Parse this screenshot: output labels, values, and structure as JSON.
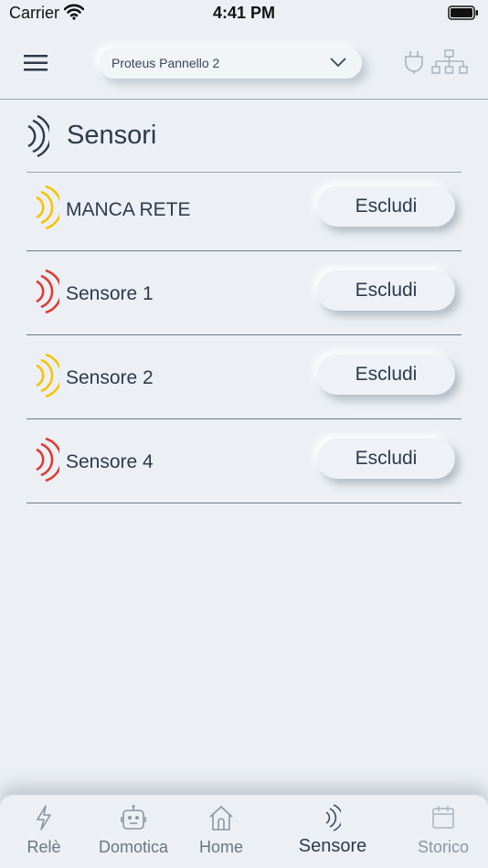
{
  "status_bar": {
    "carrier": "Carrier",
    "time": "4:41 PM"
  },
  "header": {
    "panel_selector": "Proteus Pannello 2",
    "icons": [
      "menu-icon",
      "plug-icon",
      "network-icon"
    ]
  },
  "section": {
    "title": "Sensori",
    "icon": "sensor-wave-icon"
  },
  "sensors": [
    {
      "name": "MANCA RETE",
      "status_color": "#f5c400",
      "action": "Escludi"
    },
    {
      "name": "Sensore 1",
      "status_color": "#e03a32",
      "action": "Escludi"
    },
    {
      "name": "Sensore 2",
      "status_color": "#f5c400",
      "action": "Escludi"
    },
    {
      "name": "Sensore 4",
      "status_color": "#e03a32",
      "action": "Escludi"
    }
  ],
  "tabs": [
    {
      "label": "Relè",
      "icon": "bolt-icon"
    },
    {
      "label": "Domotica",
      "icon": "robot-icon"
    },
    {
      "label": "Home",
      "icon": "home-icon"
    },
    {
      "label": "Sensore",
      "icon": "sensor-wave-icon",
      "active": true
    },
    {
      "label": "Storico",
      "icon": "calendar-icon"
    }
  ],
  "colors": {
    "background": "#ecf0f4",
    "text": "#2e3a4c",
    "alarm_yellow": "#f5c400",
    "alarm_red": "#e03a32"
  }
}
